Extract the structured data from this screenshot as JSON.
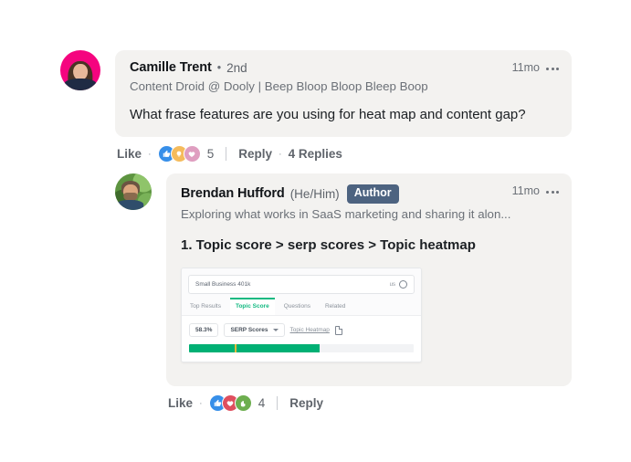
{
  "root_comment": {
    "avatar": "camille-avatar",
    "author_name": "Camille Trent",
    "separator": "•",
    "degree": "2nd",
    "headline": "Content Droid @ Dooly | Beep Bloop Bloop Bleep Boop",
    "timestamp": "11mo",
    "menu_icon": "kebab-menu-icon",
    "body": "What frase features are you using for heat map and content gap?",
    "actions": {
      "like_label": "Like",
      "separator": "·",
      "reactions": [
        {
          "name": "like-reaction-icon",
          "glyph": "☝",
          "color": "#378fe9"
        },
        {
          "name": "insightful-reaction-icon",
          "glyph": "●",
          "color": "#f5bb5c"
        },
        {
          "name": "love-reaction-icon",
          "glyph": "♥",
          "color": "#df9ec0"
        }
      ],
      "reaction_count": "5",
      "reply_label": "Reply",
      "replies_label": "4 Replies"
    }
  },
  "reply_comment": {
    "avatar": "brendan-avatar",
    "author_name": "Brendan Hufford",
    "pronouns": "(He/Him)",
    "author_badge": "Author",
    "headline": "Exploring what works in SaaS marketing and sharing it alon...",
    "timestamp": "11mo",
    "menu_icon": "kebab-menu-icon",
    "body": "1. Topic score > serp scores > Topic heatmap",
    "embed": {
      "search_value": "Small Business 401k",
      "country_label": "us",
      "gear_icon": "gear-icon",
      "tabs": [
        {
          "label": "Top Results",
          "active": false
        },
        {
          "label": "Topic Score",
          "active": true
        },
        {
          "label": "Questions",
          "active": false
        },
        {
          "label": "Related",
          "active": false
        }
      ],
      "score_badge": "58.3%",
      "dropdown_label": "SERP Scores",
      "dropdown_caret": "chevron-down-icon",
      "heatmap_link": "Topic Heatmap",
      "doc_icon": "document-icon",
      "progress": {
        "fill_percent": 58.3,
        "marker_percent": 20.5,
        "fill_color": "#00b074",
        "marker_color": "#e8b93a",
        "track_color": "#f2f3f5"
      }
    },
    "actions": {
      "like_label": "Like",
      "separator": "·",
      "reactions": [
        {
          "name": "like-reaction-icon",
          "glyph": "☝",
          "color": "#378fe9"
        },
        {
          "name": "heart-reaction-icon",
          "glyph": "♥",
          "color": "#df4f5e"
        },
        {
          "name": "support-reaction-icon",
          "glyph": "●",
          "color": "#6dae4f"
        }
      ],
      "reaction_count": "4",
      "reply_label": "Reply"
    }
  },
  "theme": {
    "bubble_bg": "#f3f2f0",
    "author_badge_bg": "#4d6380",
    "accent_green": "#12b981",
    "page_bg": "#ffffff"
  }
}
